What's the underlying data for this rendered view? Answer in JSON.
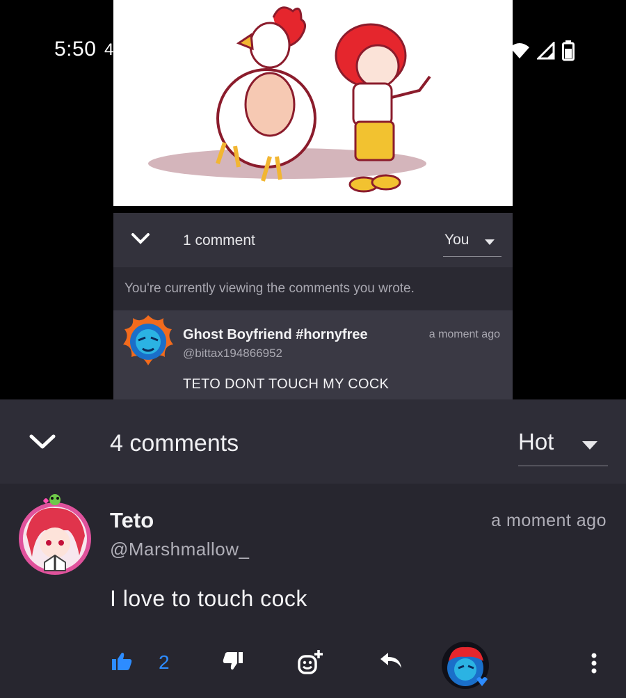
{
  "status_bar": {
    "time": "5:50",
    "notification_glyph": "4",
    "icons": [
      "wifi-icon",
      "signal-icon",
      "battery-icon"
    ]
  },
  "inner_panel": {
    "comment_count": "1 comment",
    "sort_value": "You",
    "info_text": "You're currently viewing the comments you wrote.",
    "comment": {
      "author": "Ghost Boyfriend #hornyfree",
      "handle": "@bittax194866952",
      "time": "a moment ago",
      "body": "TETO DONT TOUCH MY COCK"
    }
  },
  "comments_sheet": {
    "comment_count": "4 comments",
    "sort_value": "Hot",
    "comment": {
      "author": "Teto",
      "handle": "@Marshmallow_",
      "time": "a moment ago",
      "body": "I love to touch cock",
      "like_count": "2"
    }
  },
  "colors": {
    "accent_blue": "#2d8cff",
    "sheet_bg": "#27262f",
    "header_bg": "#2e2d37",
    "avatar_ring": "#e0529c"
  }
}
